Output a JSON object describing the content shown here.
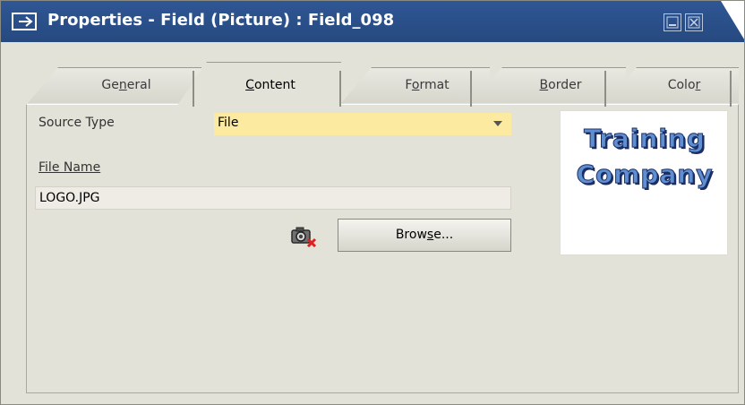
{
  "window": {
    "title": "Properties - Field (Picture) : Field_098",
    "colors": {
      "titlebar": "#2f5795",
      "body": "#e3e2d8",
      "source_highlight": "#fbeaa0"
    }
  },
  "tabs": [
    {
      "pre": "Ge",
      "key": "n",
      "post": "eral",
      "active": false
    },
    {
      "pre": "",
      "key": "C",
      "post": "ontent",
      "active": true
    },
    {
      "pre": "F",
      "key": "o",
      "post": "rmat",
      "active": false
    },
    {
      "pre": "",
      "key": "B",
      "post": "order",
      "active": false
    },
    {
      "pre": "Colo",
      "key": "r",
      "post": "",
      "active": false
    }
  ],
  "content": {
    "source_type_label": "Source Type",
    "source_type_value": "File",
    "file_name_label": "File Name",
    "file_name_value": "LOGO.JPG",
    "browse": {
      "pre": "Brow",
      "key": "s",
      "post": "e..."
    }
  },
  "preview": {
    "logo_line1": "Training",
    "logo_line2": "Company"
  },
  "icons": {
    "title": "properties-icon",
    "minimize": "minimize-icon",
    "close": "close-icon",
    "clear_picture": "camera-delete-icon",
    "dropdown": "chevron-down-icon"
  }
}
